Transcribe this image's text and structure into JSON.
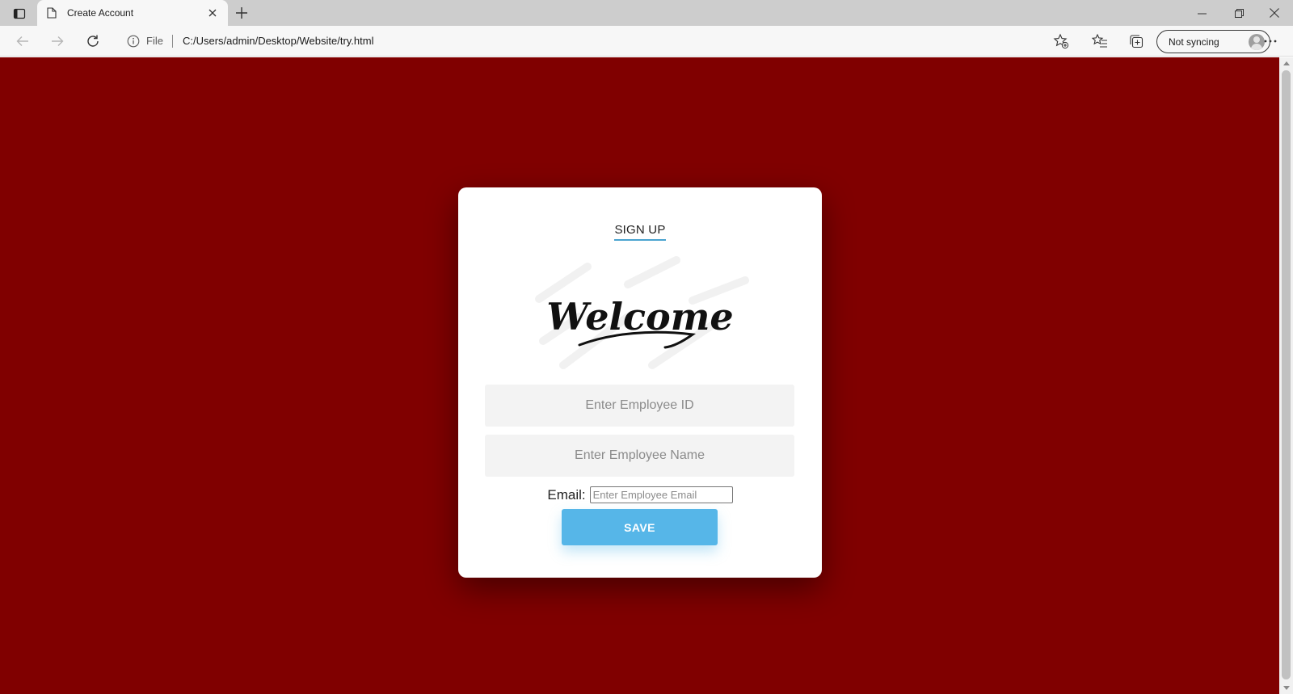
{
  "browser": {
    "tab": {
      "title": "Create Account"
    },
    "address": {
      "scheme_label": "File",
      "url": "C:/Users/admin/Desktop/Website/try.html"
    },
    "profile": {
      "sync_label": "Not syncing"
    },
    "icons": {
      "tab_actions": "tab-actions-icon",
      "page": "page-icon",
      "tab_close": "close-icon",
      "new_tab": "plus-icon",
      "minimize": "minimize-icon",
      "restore": "restore-icon",
      "close_window": "close-icon",
      "back": "back-arrow-icon",
      "forward": "forward-arrow-icon",
      "refresh": "refresh-icon",
      "info": "info-icon",
      "add_favorite": "add-favorite-icon",
      "favorites": "favorites-icon",
      "collections": "collections-icon",
      "more": "more-icon"
    }
  },
  "page": {
    "background_color": "#800000",
    "card": {
      "title": "SIGN UP",
      "welcome_image": {
        "text": "Welcome"
      },
      "employee_id": {
        "placeholder": "Enter Employee ID",
        "value": ""
      },
      "employee_name": {
        "placeholder": "Enter Employee Name",
        "value": ""
      },
      "email": {
        "label": "Email:",
        "placeholder": "Enter Employee Email",
        "value": ""
      },
      "save_button": {
        "label": "SAVE"
      },
      "colors": {
        "accent": "#56b6e8",
        "underline": "#4aa3cf"
      }
    }
  }
}
